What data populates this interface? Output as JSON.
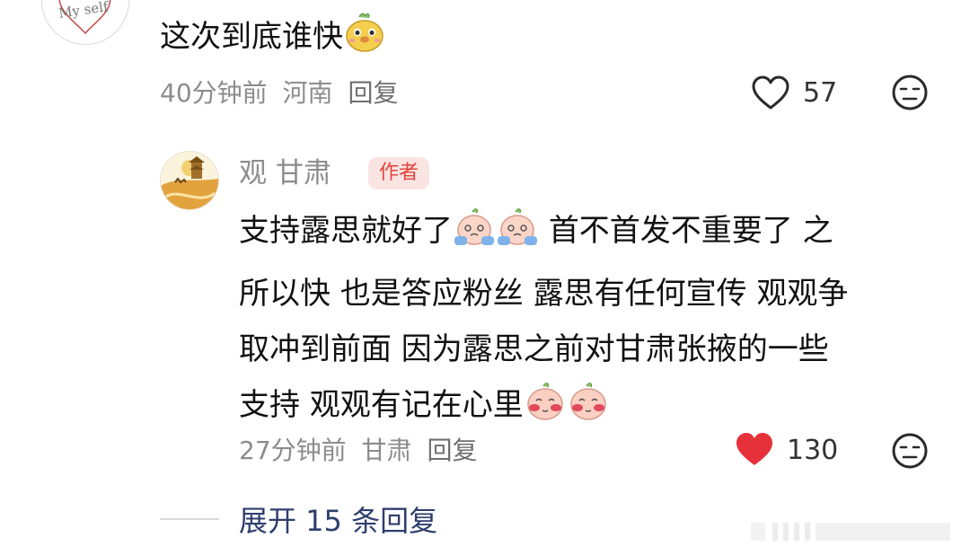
{
  "comment": {
    "text": "这次到底谁快",
    "time": "40分钟前",
    "location": "河南",
    "reply_label": "回复",
    "like_count": "57",
    "avatar_text": "My self"
  },
  "author_reply": {
    "name": "观 甘肃",
    "badge": "作者",
    "line1_a": "支持露思就好了",
    "line1_b": "首不首发不重要了 之",
    "line2": "所以快 也是答应粉丝 露思有任何宣传 观观争",
    "line3": "取冲到前面 因为露思之前对甘肃张掖的一些",
    "line4": "支持 观观有记在心里",
    "time": "27分钟前",
    "location": "甘肃",
    "reply_label": "回复",
    "like_count": "130"
  },
  "expand_label": "展开 15 条回复",
  "colors": {
    "liked": "#e5313a",
    "meta": "#8c8c8c",
    "expand": "#2e3e6e",
    "badge_text": "#e2443d",
    "badge_bg": "#f9e4e2"
  },
  "icons": {
    "like_outline": "heart-outline-icon",
    "like_filled": "heart-filled-icon",
    "face": "neutral-face-icon"
  }
}
